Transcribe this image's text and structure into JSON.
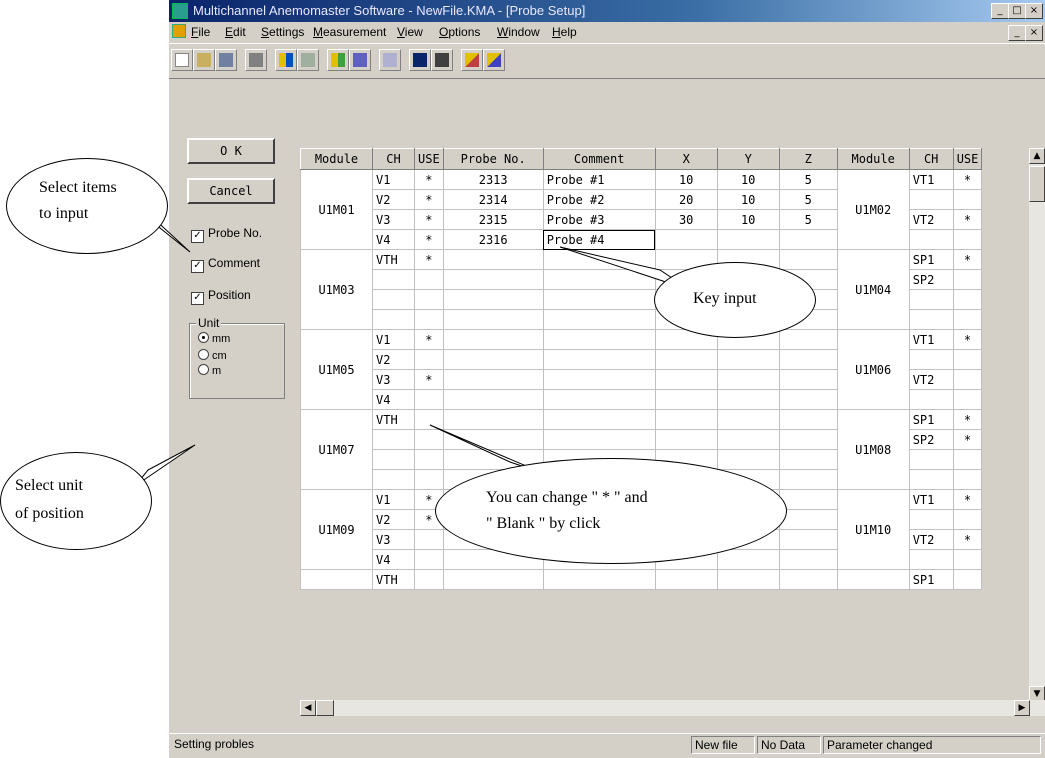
{
  "window": {
    "title": "Multichannel Anemomaster Software - NewFile.KMA - [Probe Setup]",
    "title_icon": "app-icon",
    "controls": [
      "_",
      "□",
      "×"
    ]
  },
  "menu": [
    "File",
    "Edit",
    "Settings",
    "Measurement",
    "View",
    "Options",
    "Window",
    "Help"
  ],
  "toolbar": {
    "icons": [
      "new-icon",
      "open-icon",
      "save-icon",
      "print-icon",
      "probe-setup-icon",
      "sensor-icon",
      "measure-icon",
      "monitor-icon",
      "table-icon",
      "window-icon",
      "graph-icon",
      "graph2-icon"
    ]
  },
  "panel": {
    "ok_label": "O K",
    "cancel_label": "Cancel",
    "checks": [
      {
        "label": "Probe No.",
        "checked": true
      },
      {
        "label": "Comment",
        "checked": true
      },
      {
        "label": "Position",
        "checked": true
      }
    ],
    "unit_label": "Unit",
    "units": [
      {
        "label": "mm",
        "selected": true
      },
      {
        "label": "cm",
        "selected": false
      },
      {
        "label": "m",
        "selected": false
      }
    ]
  },
  "grid": {
    "headers": [
      "Module",
      "CH",
      "USE",
      "Probe No.",
      "Comment",
      "X",
      "Y",
      "Z",
      "Module",
      "CH",
      "USE"
    ],
    "blocks": [
      {
        "left_module": "U1M01",
        "right_module": "U1M02",
        "rows": [
          {
            "ch": "V1",
            "use": "*",
            "probe": "2313",
            "comment": "Probe #1",
            "x": "10",
            "y": "10",
            "z": "5",
            "rch": "VT1",
            "ruse": "*"
          },
          {
            "ch": "V2",
            "use": "*",
            "probe": "2314",
            "comment": "Probe #2",
            "x": "20",
            "y": "10",
            "z": "5",
            "rch": "",
            "ruse": ""
          },
          {
            "ch": "V3",
            "use": "*",
            "probe": "2315",
            "comment": "Probe #3",
            "x": "30",
            "y": "10",
            "z": "5",
            "rch": "VT2",
            "ruse": "*"
          },
          {
            "ch": "V4",
            "use": "*",
            "probe": "2316",
            "comment": "Probe #4",
            "x": "",
            "y": "",
            "z": "",
            "rch": "",
            "ruse": ""
          }
        ]
      },
      {
        "left_module": "U1M03",
        "right_module": "U1M04",
        "rows": [
          {
            "ch": "VTH",
            "use": "*",
            "probe": "",
            "comment": "",
            "x": "",
            "y": "",
            "z": "",
            "rch": "SP1",
            "ruse": "*"
          },
          {
            "ch": "",
            "use": "",
            "probe": "",
            "comment": "",
            "x": "",
            "y": "",
            "z": "",
            "rch": "SP2",
            "ruse": ""
          },
          {
            "ch": "",
            "use": "",
            "probe": "",
            "comment": "",
            "x": "",
            "y": "",
            "z": "",
            "rch": "",
            "ruse": ""
          },
          {
            "ch": "",
            "use": "",
            "probe": "",
            "comment": "",
            "x": "",
            "y": "",
            "z": "",
            "rch": "",
            "ruse": ""
          }
        ]
      },
      {
        "left_module": "U1M05",
        "right_module": "U1M06",
        "rows": [
          {
            "ch": "V1",
            "use": "*",
            "probe": "",
            "comment": "",
            "x": "",
            "y": "",
            "z": "",
            "rch": "VT1",
            "ruse": "*"
          },
          {
            "ch": "V2",
            "use": "",
            "probe": "",
            "comment": "",
            "x": "",
            "y": "",
            "z": "",
            "rch": "",
            "ruse": ""
          },
          {
            "ch": "V3",
            "use": "*",
            "probe": "",
            "comment": "",
            "x": "",
            "y": "",
            "z": "",
            "rch": "VT2",
            "ruse": ""
          },
          {
            "ch": "V4",
            "use": "",
            "probe": "",
            "comment": "",
            "x": "",
            "y": "",
            "z": "",
            "rch": "",
            "ruse": ""
          }
        ]
      },
      {
        "left_module": "U1M07",
        "right_module": "U1M08",
        "rows": [
          {
            "ch": "VTH",
            "use": "",
            "probe": "",
            "comment": "",
            "x": "",
            "y": "",
            "z": "",
            "rch": "SP1",
            "ruse": "*"
          },
          {
            "ch": "",
            "use": "",
            "probe": "",
            "comment": "",
            "x": "",
            "y": "",
            "z": "",
            "rch": "SP2",
            "ruse": "*"
          },
          {
            "ch": "",
            "use": "",
            "probe": "",
            "comment": "",
            "x": "",
            "y": "",
            "z": "",
            "rch": "",
            "ruse": ""
          },
          {
            "ch": "",
            "use": "",
            "probe": "",
            "comment": "",
            "x": "",
            "y": "",
            "z": "",
            "rch": "",
            "ruse": ""
          }
        ]
      },
      {
        "left_module": "U1M09",
        "right_module": "U1M10",
        "rows": [
          {
            "ch": "V1",
            "use": "*",
            "probe": "",
            "comment": "",
            "x": "",
            "y": "",
            "z": "",
            "rch": "VT1",
            "ruse": "*"
          },
          {
            "ch": "V2",
            "use": "*",
            "probe": "",
            "comment": "",
            "x": "",
            "y": "",
            "z": "",
            "rch": "",
            "ruse": ""
          },
          {
            "ch": "V3",
            "use": "",
            "probe": "",
            "comment": "",
            "x": "",
            "y": "",
            "z": "",
            "rch": "VT2",
            "ruse": "*"
          },
          {
            "ch": "V4",
            "use": "",
            "probe": "",
            "comment": "",
            "x": "",
            "y": "",
            "z": "",
            "rch": "",
            "ruse": ""
          }
        ]
      }
    ],
    "partial_row": {
      "ch": "VTH",
      "rch": "SP1"
    }
  },
  "status": {
    "message": "Setting probles",
    "file": "New file",
    "data": "No Data",
    "param": "Parameter changed"
  },
  "callouts": {
    "select_items": [
      "Select  items",
      "to input"
    ],
    "key_input": "Key input",
    "change_use": [
      "You can change \" * \" and",
      "\" Blank \" by click"
    ],
    "select_unit": [
      "Select unit",
      "of position"
    ]
  }
}
